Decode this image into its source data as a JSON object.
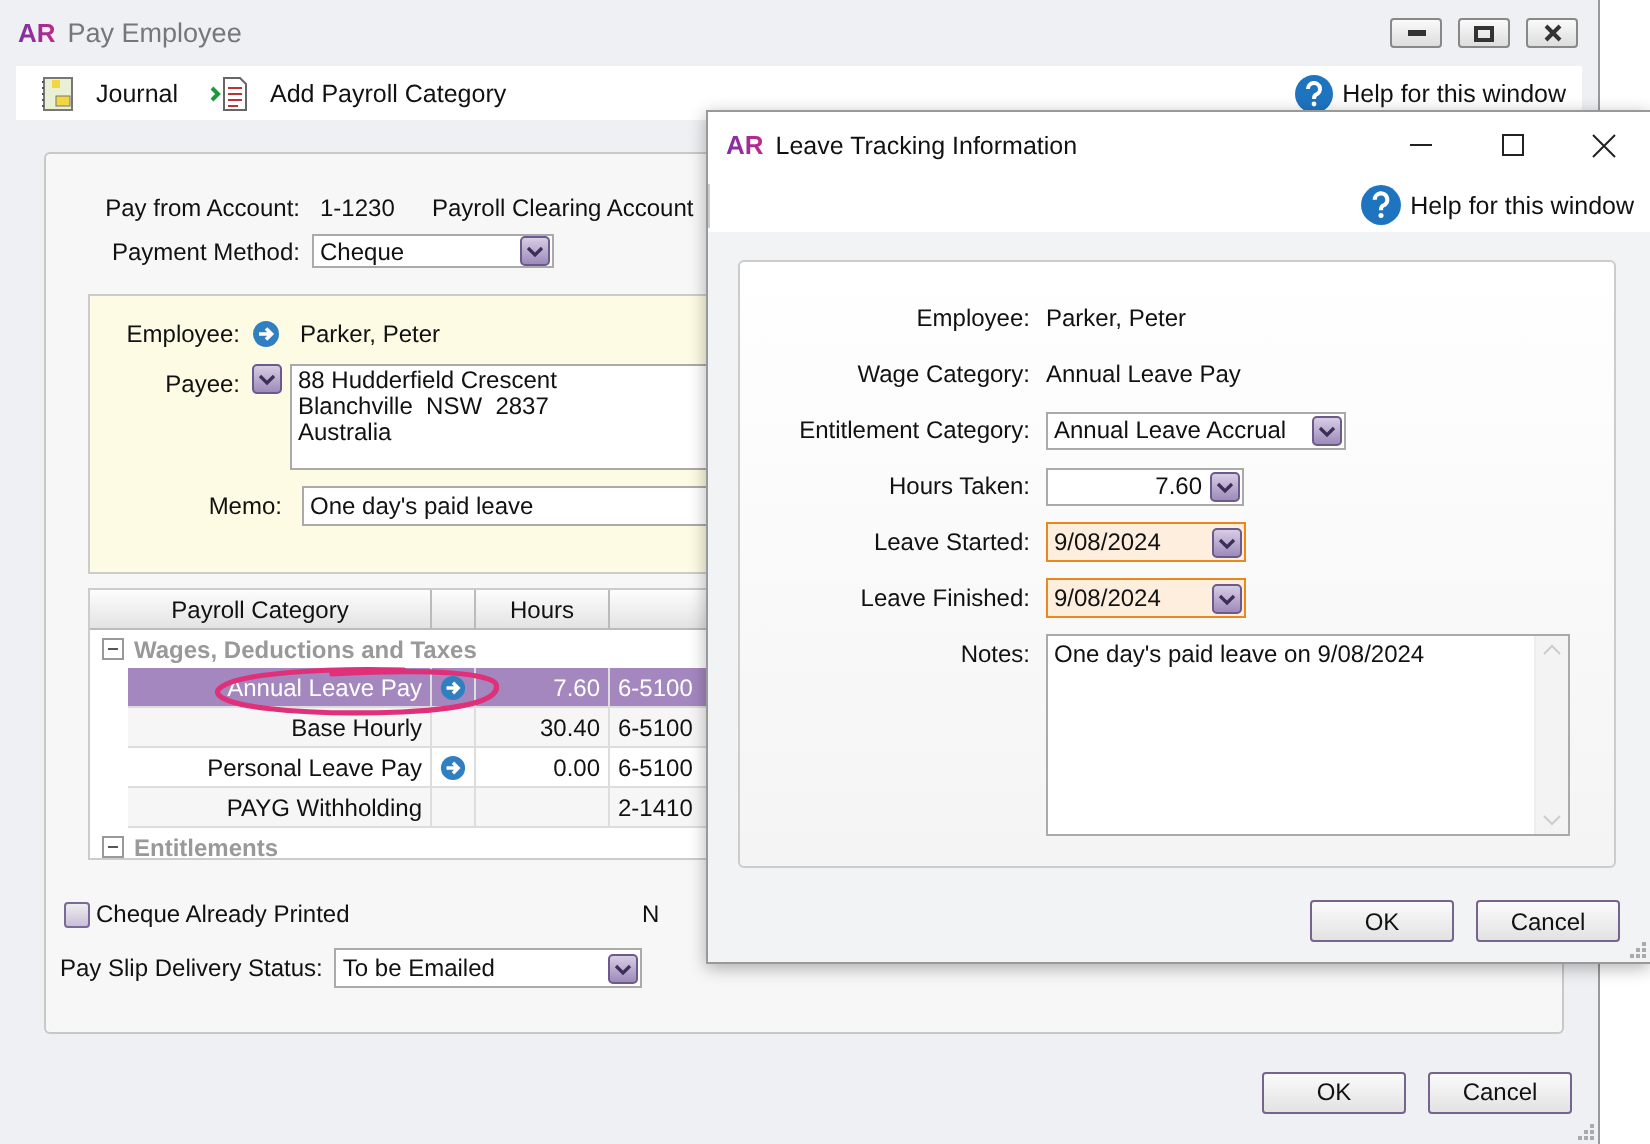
{
  "main_window": {
    "logo": "AR",
    "title": "Pay Employee",
    "toolbar": [
      {
        "kind": "journal",
        "label": "Journal"
      },
      {
        "kind": "add",
        "label": "Add Payroll Category"
      }
    ],
    "help": "Help for this window",
    "pay_from_account": {
      "label": "Pay from Account:",
      "number": "1-1230",
      "name": "Payroll Clearing Account"
    },
    "payment_method": {
      "label": "Payment Method:",
      "value": "Cheque"
    },
    "employee": {
      "label": "Employee:",
      "value": "Parker, Peter"
    },
    "payee": {
      "label": "Payee:",
      "lines": [
        "88 Hudderfield Crescent",
        "Blanchville  NSW  2837",
        "Australia"
      ]
    },
    "memo": {
      "label": "Memo:",
      "value": "One day's paid leave"
    },
    "table": {
      "columns": {
        "category": "Payroll Category",
        "hours": "Hours"
      },
      "groups": [
        {
          "title": "Wages, Deductions and Taxes",
          "expanded": true,
          "rows": [
            {
              "category": "Annual Leave Pay",
              "has_link": true,
              "hours": "7.60",
              "account": "6-5100",
              "selected": true
            },
            {
              "category": "Base Hourly",
              "has_link": false,
              "hours": "30.40",
              "account": "6-5100",
              "selected": false
            },
            {
              "category": "Personal Leave Pay",
              "has_link": true,
              "hours": "0.00",
              "account": "6-5100",
              "selected": false
            },
            {
              "category": "PAYG Withholding",
              "has_link": false,
              "account": "2-1410",
              "selected": false
            }
          ]
        },
        {
          "title": "Entitlements",
          "expanded": true
        }
      ]
    },
    "cheque_printed": {
      "label": "Cheque Already Printed",
      "checked": false
    },
    "partial_label": "N",
    "delivery_status": {
      "label": "Pay Slip Delivery Status:",
      "value": "To be Emailed"
    },
    "buttons": [
      "OK",
      "Cancel"
    ]
  },
  "dialog": {
    "logo": "AR",
    "title": "Leave Tracking Information",
    "help": "Help for this window",
    "fields": [
      {
        "kind": "text",
        "label": "Employee:",
        "value": "Parker, Peter"
      },
      {
        "kind": "text",
        "label": "Wage Category:",
        "value": "Annual Leave Pay"
      },
      {
        "kind": "select",
        "label": "Entitlement Category:",
        "value": "Annual Leave Accrual"
      },
      {
        "kind": "number",
        "label": "Hours Taken:",
        "value": "7.60"
      },
      {
        "kind": "date",
        "label": "Leave Started:",
        "value": "9/08/2024"
      },
      {
        "kind": "date",
        "label": "Leave Finished:",
        "value": "9/08/2024"
      },
      {
        "kind": "notes",
        "label": "Notes:",
        "value": "One day's paid leave on 9/08/2024"
      }
    ],
    "buttons": [
      "OK",
      "Cancel"
    ]
  }
}
